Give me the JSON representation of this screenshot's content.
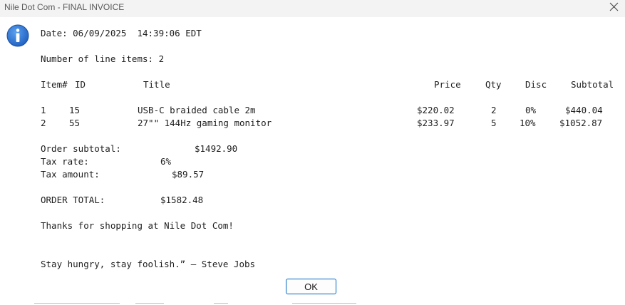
{
  "window": {
    "title": "Nile Dot Com - FINAL INVOICE"
  },
  "icons": {
    "info": "info-icon",
    "close": "close-icon"
  },
  "invoice": {
    "date_line": "Date: 06/09/2025  14:39:06 EDT",
    "line_items_line": "Number of line items: 2",
    "headers": {
      "item": "Item#",
      "id": "ID",
      "title": "Title",
      "price": "Price",
      "qty": "Qty",
      "disc": "Disc",
      "subtotal": "Subtotal"
    },
    "rows": [
      {
        "item": "1",
        "id": "15",
        "title": "USB-C braided cable 2m",
        "price": "$220.02",
        "qty": "2",
        "disc": "0%",
        "subtotal": "$440.04"
      },
      {
        "item": "2",
        "id": "55",
        "title": "27\"\" 144Hz gaming monitor",
        "price": "$233.97",
        "qty": "5",
        "disc": "10%",
        "subtotal": "$1052.87"
      }
    ],
    "order_subtotal_label": "Order subtotal:",
    "order_subtotal_value": "$1492.90",
    "tax_rate_label": "Tax rate:",
    "tax_rate_value": "6%",
    "tax_amount_label": "Tax amount:",
    "tax_amount_value": "$89.57",
    "order_total_label": "ORDER TOTAL:",
    "order_total_value": "$1582.48",
    "thanks": "Thanks for shopping at Nile Dot Com!",
    "quote": "Stay hungry, stay foolish.” — Steve Jobs"
  },
  "buttons": {
    "ok": "OK"
  },
  "colors": {
    "accent": "#0067c0",
    "icon_blue": "#1f5fbf"
  }
}
